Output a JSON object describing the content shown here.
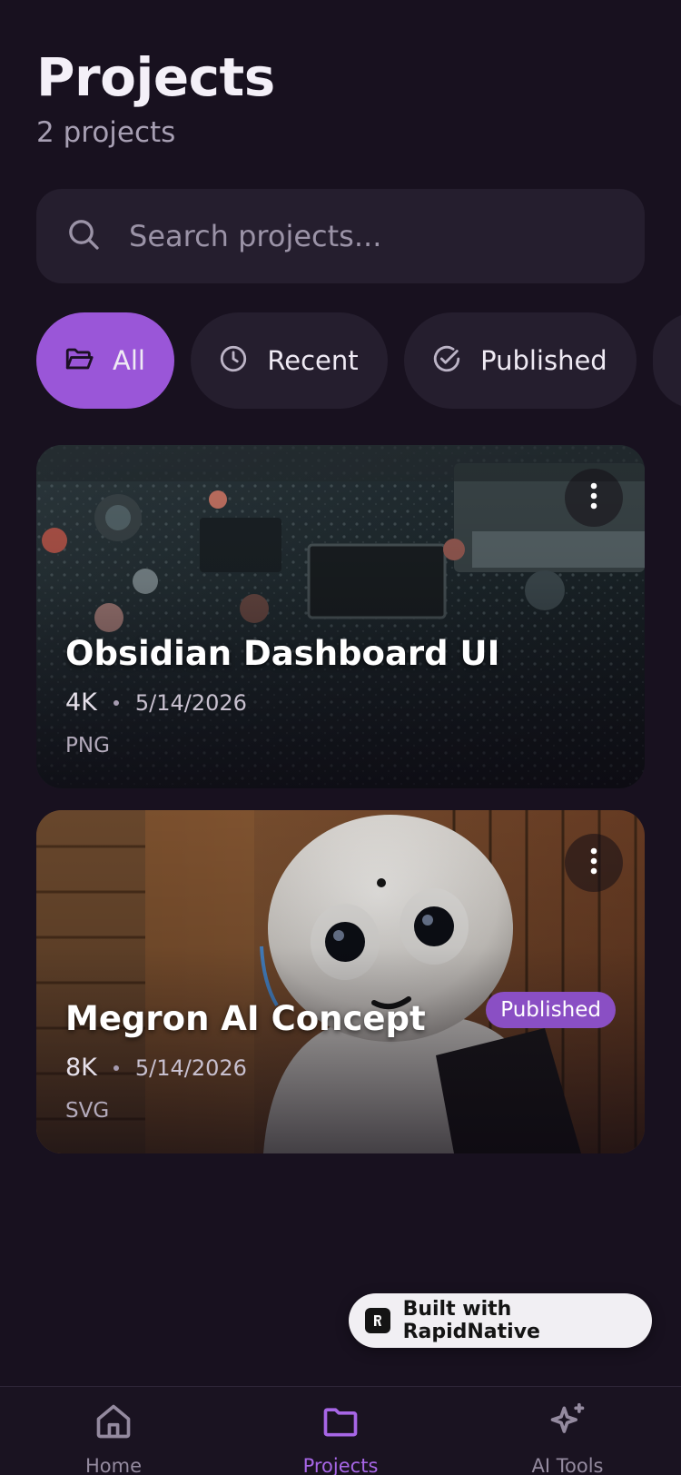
{
  "header": {
    "title": "Projects",
    "subtitle": "2 projects"
  },
  "search": {
    "placeholder": "Search projects...",
    "value": "",
    "icon": "search-icon"
  },
  "filters": [
    {
      "label": "All",
      "icon": "folder-open-icon",
      "active": true
    },
    {
      "label": "Recent",
      "icon": "clock-icon",
      "active": false
    },
    {
      "label": "Published",
      "icon": "check-circle-icon",
      "active": false
    },
    {
      "label": "",
      "icon": "edit-icon",
      "active": false
    }
  ],
  "projects": [
    {
      "title": "Obsidian Dashboard UI",
      "size": "4K",
      "date": "5/14/2026",
      "type": "PNG",
      "badge": ""
    },
    {
      "title": "Megron AI Concept",
      "size": "8K",
      "date": "5/14/2026",
      "type": "SVG",
      "badge": "Published"
    }
  ],
  "built_with": {
    "label": "Built with RapidNative"
  },
  "tabbar": [
    {
      "label": "Home",
      "icon": "home-icon",
      "active": false
    },
    {
      "label": "Projects",
      "icon": "folder-icon",
      "active": true
    },
    {
      "label": "AI Tools",
      "icon": "sparkles-icon",
      "active": false
    }
  ],
  "colors": {
    "background": "#18111f",
    "accent": "#9a56d8",
    "surface": "#251e2e",
    "badge": "#8a4fc4"
  }
}
